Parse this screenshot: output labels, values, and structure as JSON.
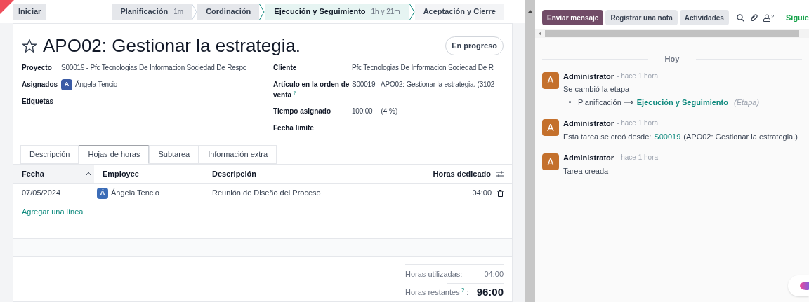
{
  "start_button": "Iniciar",
  "stages": [
    {
      "name": "Planificación",
      "duration": "1m",
      "selected": false
    },
    {
      "name": "Cordinación",
      "selected": false
    },
    {
      "name": "Ejecución y Seguimiento",
      "duration": "1h y 21m",
      "selected": true
    },
    {
      "name": "Aceptación y Cierre",
      "selected": false
    }
  ],
  "task": {
    "title": "APO02: Gestionar la estrategia.",
    "starred": false,
    "status": "En progreso"
  },
  "left_fields": [
    {
      "label": "Proyecto",
      "value": "S00019 - Pfc Tecnologias De Informacion Sociedad De Respc"
    },
    {
      "label": "Asignados",
      "value": "Ángela Tencio",
      "avatar": "A"
    },
    {
      "label": "Etiquetas"
    }
  ],
  "right_fields": [
    {
      "label": "Artículo en la orden de venta",
      "label_help": "?",
      "value": "S00019 - APO02: Gestionar la estrategia. (3102"
    },
    {
      "label": "Tiempo asignado",
      "value": "100:00",
      "extra": "(4 %)"
    },
    {
      "label": "Fecha límite"
    }
  ],
  "client_field": {
    "label": "Cliente",
    "value": "Pfc Tecnologias De Informacion Sociedad De R"
  },
  "tabs": [
    {
      "label": "Descripción",
      "selected": false
    },
    {
      "label": "Hojas de horas",
      "selected": true
    },
    {
      "label": "Subtarea",
      "selected": false
    },
    {
      "label": "Información extra",
      "selected": false
    }
  ],
  "table": {
    "columns": [
      "Fecha",
      "Employee",
      "Descripción",
      "Horas dedicado"
    ],
    "rows": [
      {
        "date": "07/05/2024",
        "avatar": "Á",
        "employee": "Ángela Tencio",
        "description": "Reunión de Diseño del Proceso",
        "hours": "04:00"
      }
    ],
    "add_line": "Agregar una línea"
  },
  "totals": [
    {
      "label": "Horas utilizadas:",
      "value": "04:00"
    },
    {
      "label": "Horas restantes",
      "help": "?",
      "suffix": ":",
      "value": "96:00"
    }
  ],
  "chatter": {
    "buttons": [
      {
        "label": "Enviar mensaje",
        "selected": true
      },
      {
        "label": "Registrar una nota",
        "selected": false
      },
      {
        "label": "Actividades",
        "selected": false
      }
    ],
    "followers_count": "2",
    "follow": "Siguie",
    "day": "Hoy",
    "messages": [
      {
        "avatar": "A",
        "author": "Administrator",
        "time": "- hace 1 hora",
        "body": "Se cambió la etapa",
        "tracking": {
          "old": "Planificación",
          "new": "Ejecución y Seguimiento",
          "field": "(Etapa)"
        }
      },
      {
        "avatar": "A",
        "author": "Administrator",
        "time": "- hace 1 hora",
        "body": "Esta tarea se creó desde:",
        "link": "S00019",
        "after": "(APO02: Gestionar la estrategia.)"
      },
      {
        "avatar": "A",
        "author": "Administrator",
        "time": "- hace 1 hora",
        "body": "Tarea creada"
      }
    ]
  }
}
